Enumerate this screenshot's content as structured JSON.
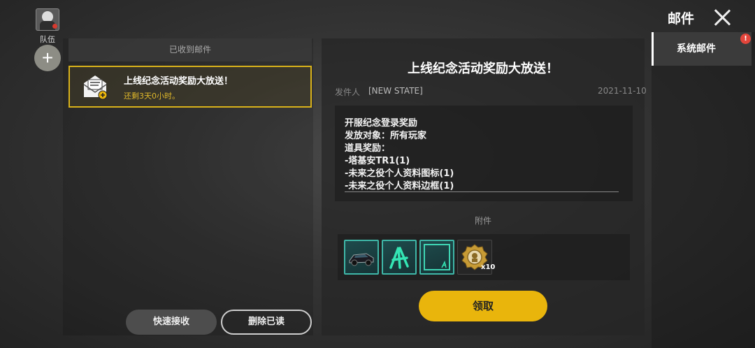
{
  "team": {
    "label": "队伍",
    "add_symbol": "+"
  },
  "header": {
    "title": "邮件"
  },
  "tabs": [
    {
      "label": "系统邮件",
      "badge": "!"
    }
  ],
  "inbox": {
    "header": "已收到邮件",
    "items": [
      {
        "title": "上线纪念活动奖励大放送！",
        "subtitle": "还剩3天0小时。"
      }
    ],
    "quick_receive_label": "快速接收",
    "delete_read_label": "删除已读"
  },
  "detail": {
    "title": "上线纪念活动奖励大放送！",
    "sender_label": "发件人",
    "sender": "[NEW STATE]",
    "date": "2021-11-10",
    "body": [
      "开服纪念登录奖励",
      "发放对象：所有玩家",
      "道具奖励：",
      "-塔基安TR1(1)",
      "-未来之役个人资料图标(1)",
      "-未来之役个人资料边框(1)"
    ],
    "attachments_label": "附件",
    "attachments": [
      {
        "icon": "car-icon"
      },
      {
        "icon": "profile-emblem-icon"
      },
      {
        "icon": "profile-frame-icon"
      },
      {
        "icon": "medal-coin-icon",
        "qty": "x10"
      }
    ],
    "claim_label": "领取"
  },
  "colors": {
    "accent": "#e9b50c",
    "item_border": "#d9b21a",
    "teal": "#3fb7a8",
    "badge": "#e2453b"
  }
}
